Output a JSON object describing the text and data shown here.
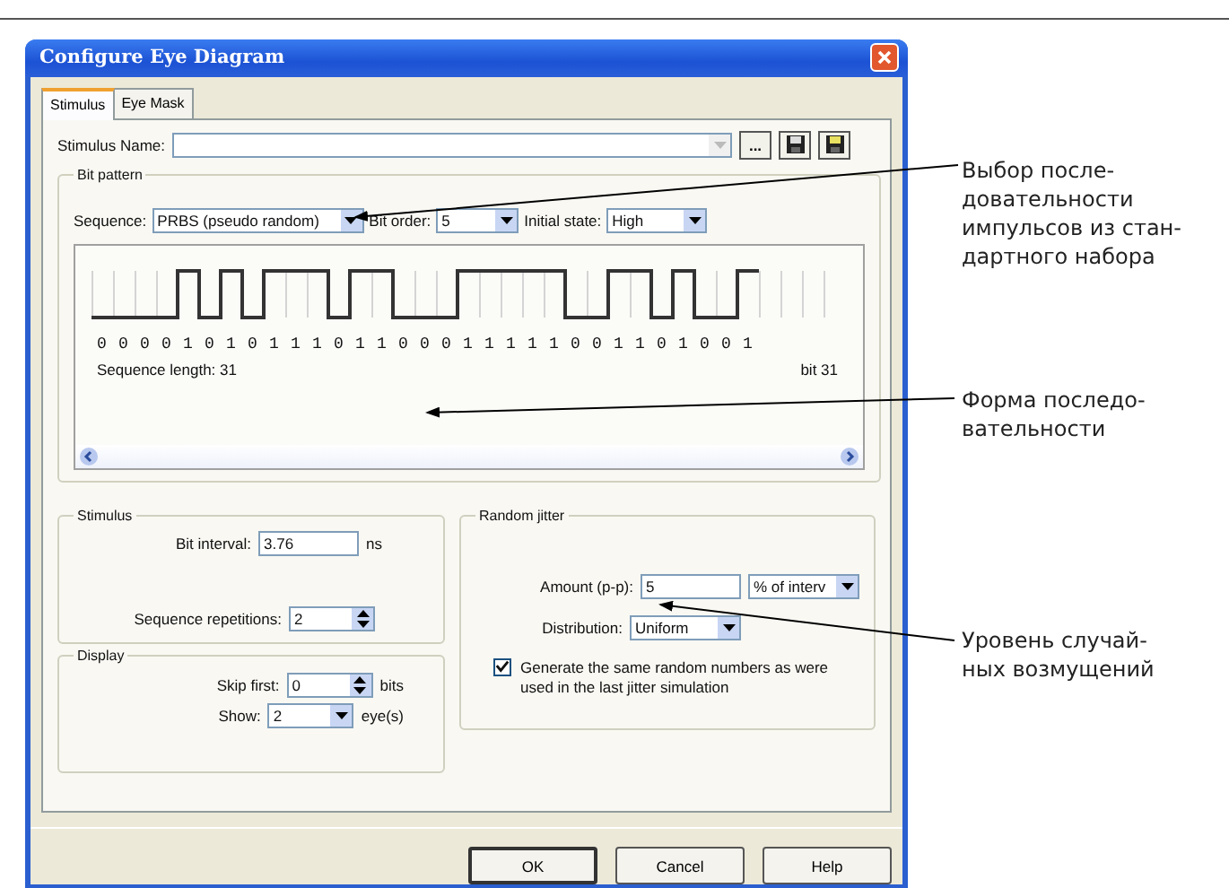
{
  "window": {
    "title": "Configure Eye Diagram"
  },
  "tabs": [
    {
      "label": "Stimulus",
      "selected": true
    },
    {
      "label": "Eye Mask",
      "selected": false
    }
  ],
  "stimulus_name": {
    "label": "Stimulus Name:",
    "browse": "..."
  },
  "bit_pattern": {
    "title": "Bit pattern",
    "sequence": {
      "label": "Sequence:",
      "value": "PRBS (pseudo random)"
    },
    "bit_order": {
      "label": "Bit order:",
      "value": "5"
    },
    "initial_state": {
      "label": "Initial state:",
      "value": "High"
    },
    "bits": "0 0 0 0 1 0 1 0 1 1 1 0 1 1 0 0 0 1 1 1 1 1 0 0 1 1 0 1 0 0 1",
    "sequence_length": "Sequence length: 31",
    "bit_marker": "bit 31"
  },
  "stimulus": {
    "title": "Stimulus",
    "bit_interval": {
      "label": "Bit interval:",
      "value": "3.76",
      "unit": "ns"
    },
    "repetitions": {
      "label": "Sequence repetitions:",
      "value": "2"
    }
  },
  "display": {
    "title": "Display",
    "skip_first": {
      "label": "Skip first:",
      "value": "0",
      "unit": "bits"
    },
    "show": {
      "label": "Show:",
      "value": "2",
      "unit": "eye(s)"
    }
  },
  "random_jitter": {
    "title": "Random jitter",
    "amount": {
      "label": "Amount (p-p):",
      "value": "5",
      "unit": "% of interv"
    },
    "distribution": {
      "label": "Distribution:",
      "value": "Uniform"
    },
    "same_random": {
      "label": "Generate the same random numbers as were used in the last jitter simulation",
      "checked": true
    }
  },
  "buttons": [
    "OK",
    "Cancel",
    "Help"
  ],
  "callouts": [
    {
      "lines": [
        "Выбор после-",
        "довательности",
        "импульсов из стан-",
        "дартного набора"
      ]
    },
    {
      "lines": [
        "Форма последо-",
        "вательности"
      ]
    },
    {
      "lines": [
        "Уровень случай-",
        "ных возмущений"
      ]
    }
  ]
}
